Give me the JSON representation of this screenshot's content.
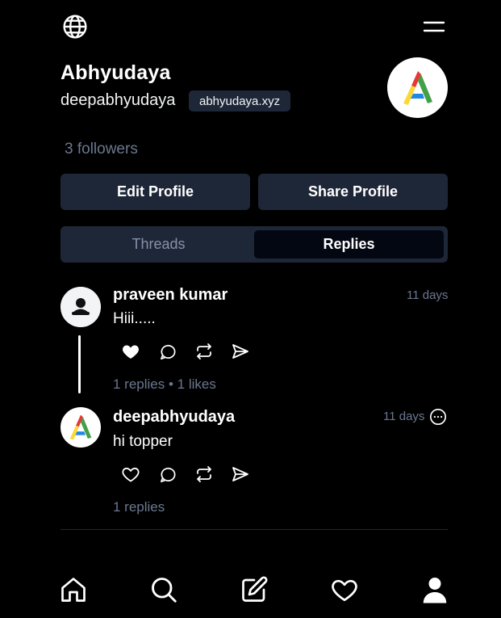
{
  "profile": {
    "display_name": "Abhyudaya",
    "username": "deepabhyudaya",
    "domain": "abhyudaya.xyz",
    "followers": "3 followers",
    "avatar_icon": "logo-a-colorful"
  },
  "buttons": {
    "edit": "Edit Profile",
    "share": "Share Profile"
  },
  "tabs": {
    "threads": "Threads",
    "replies": "Replies",
    "active": "Replies"
  },
  "posts": [
    {
      "author": "praveen kumar",
      "text": "Hiii.....",
      "time": "11 days",
      "stats": "1 replies • 1 likes",
      "liked": true,
      "avatar_icon": "user-silhouette-icon"
    },
    {
      "author": "deepabhyudaya",
      "text": "hi topper",
      "time": "11 days",
      "stats": "1 replies",
      "liked": false,
      "avatar_icon": "logo-a-colorful"
    }
  ],
  "nav": [
    "home-icon",
    "search-icon",
    "compose-icon",
    "heart-icon",
    "profile-icon"
  ],
  "colors": {
    "background": "#000000",
    "surface": "#1e2737",
    "muted": "#6b7890",
    "active_tab": "#030712"
  }
}
